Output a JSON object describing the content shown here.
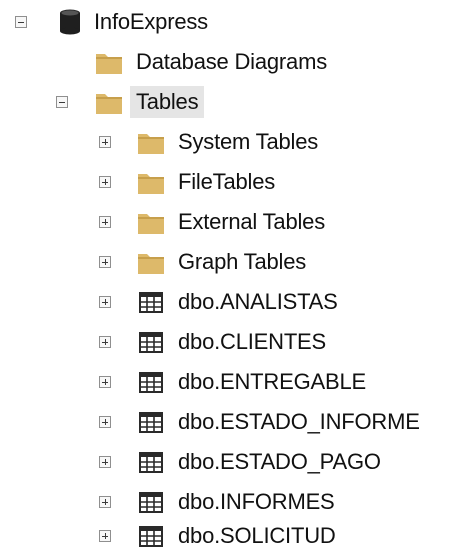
{
  "tree": {
    "root": {
      "label": "InfoExpress",
      "expander": "collapse",
      "icon": "database-icon"
    },
    "database_diagrams": {
      "label": "Database Diagrams",
      "icon": "folder-icon"
    },
    "tables": {
      "label": "Tables",
      "expander": "collapse",
      "icon": "folder-icon"
    },
    "children": [
      {
        "label": "System Tables",
        "icon": "folder-icon",
        "expander": "expand"
      },
      {
        "label": "FileTables",
        "icon": "folder-icon",
        "expander": "expand"
      },
      {
        "label": "External Tables",
        "icon": "folder-icon",
        "expander": "expand"
      },
      {
        "label": "Graph Tables",
        "icon": "folder-icon",
        "expander": "expand"
      },
      {
        "label": "dbo.ANALISTAS",
        "icon": "table-icon",
        "expander": "expand"
      },
      {
        "label": "dbo.CLIENTES",
        "icon": "table-icon",
        "expander": "expand"
      },
      {
        "label": "dbo.ENTREGABLE",
        "icon": "table-icon",
        "expander": "expand"
      },
      {
        "label": "dbo.ESTADO_INFORME",
        "icon": "table-icon",
        "expander": "expand"
      },
      {
        "label": "dbo.ESTADO_PAGO",
        "icon": "table-icon",
        "expander": "expand"
      },
      {
        "label": "dbo.INFORMES",
        "icon": "table-icon",
        "expander": "expand"
      },
      {
        "label": "dbo.SOLICITUD",
        "icon": "table-icon",
        "expander": "expand"
      }
    ]
  },
  "colors": {
    "folder": "#ddb96a",
    "folder_dark": "#c79f4b",
    "database": "#1f1f1f",
    "table_lines": "#2a2a2a",
    "expander_border": "#8f8f8f",
    "selected_bg": "#e5e5e5"
  }
}
